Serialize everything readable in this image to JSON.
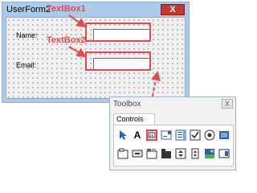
{
  "userform": {
    "title": "UserForm2",
    "close_label": "X",
    "labels": {
      "name": "Name:",
      "email": "Email:"
    }
  },
  "annotations": {
    "textbox1": "TextBox1",
    "textbox2": "TextBox2"
  },
  "toolbox": {
    "title": "Toolbox",
    "close_label": "X",
    "tab": "Controls",
    "tools_row1": [
      "select-objects-icon",
      "label-icon",
      "textbox-icon",
      "combobox-icon",
      "listbox-icon",
      "checkbox-icon",
      "optionbutton-icon",
      "togglebutton-icon"
    ],
    "tools_row2": [
      "frame-icon",
      "commandbutton-icon",
      "tabstrip-icon",
      "multipage-icon",
      "scrollbar-icon",
      "spinbutton-icon",
      "image-icon",
      "refedit-icon"
    ],
    "label_glyph": "A"
  },
  "colors": {
    "annotation": "#e8474b",
    "close_button": "#c7362b",
    "window_frame": "#aacbe9"
  }
}
